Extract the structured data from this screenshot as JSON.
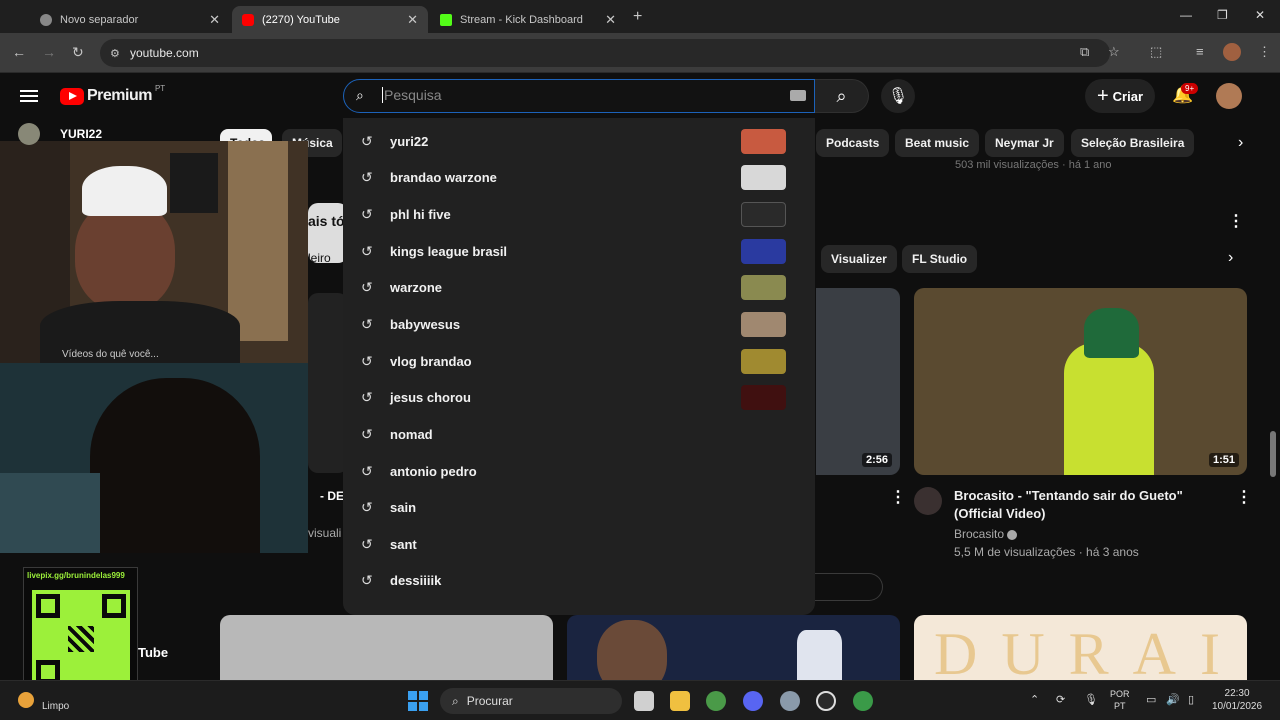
{
  "browser": {
    "tabs": [
      {
        "title": "Novo separador",
        "active": false
      },
      {
        "title": "(2270) YouTube",
        "active": true
      },
      {
        "title": "Stream - Kick Dashboard",
        "active": false
      }
    ],
    "url": "youtube.com"
  },
  "youtube": {
    "brand": "Premium",
    "region": "PT",
    "search_placeholder": "Pesquisa",
    "create_label": "Criar",
    "notification_count": "9+",
    "chips_row1": [
      "Podcasts",
      "Beat music",
      "Neymar Jr",
      "Seleção Brasileira"
    ],
    "chips_left_partial": [
      "Todos",
      "Música"
    ],
    "chips_row2": [
      "Visualizer",
      "FL Studio"
    ],
    "channel_overlay_name": "YURI22",
    "video_left_partial_meta": "Vídeos do quê você...",
    "video_partial_top_meta": "503 mil visualizações · há 1 ano",
    "videos": [
      {
        "duration": "2:56"
      },
      {
        "duration": "1:51",
        "title": "Brocasito - \"Tentando sair do Gueto\" (Official Video)",
        "channel": "Brocasito",
        "meta": "5,5 M de visualizações · há 3 anos"
      }
    ],
    "partial_texts": {
      "left_a": "ais tó",
      "left_b": "leiro",
      "left_c": "- DES",
      "left_d": "visuali",
      "bottom_left": "Tube"
    }
  },
  "suggestions": [
    {
      "text": "yuri22",
      "has_thumb": true,
      "thumb_color": "#c85a40"
    },
    {
      "text": "brandao warzone",
      "has_thumb": true,
      "thumb_color": "#d8d8d8"
    },
    {
      "text": "phl hi five",
      "has_thumb": true,
      "thumb_color": "#2a2a2a"
    },
    {
      "text": "kings league brasil",
      "has_thumb": true,
      "thumb_color": "#2a3aa0"
    },
    {
      "text": "warzone",
      "has_thumb": true,
      "thumb_color": "#8a8a50"
    },
    {
      "text": "babywesus",
      "has_thumb": true,
      "thumb_color": "#a08870"
    },
    {
      "text": "vlog brandao",
      "has_thumb": true,
      "thumb_color": "#a08a30"
    },
    {
      "text": "jesus chorou",
      "has_thumb": true,
      "thumb_color": "#401010"
    },
    {
      "text": "nomad",
      "has_thumb": false
    },
    {
      "text": "antonio pedro",
      "has_thumb": false
    },
    {
      "text": "sain",
      "has_thumb": false
    },
    {
      "text": "sant",
      "has_thumb": false
    },
    {
      "text": "dessiiiik",
      "has_thumb": false
    }
  ],
  "overlay": {
    "qr_label": "livepix.gg/brunindelas999"
  },
  "taskbar": {
    "weather": "Limpo",
    "search_label": "Procurar",
    "lang_line1": "POR",
    "lang_line2": "PT",
    "time": "22:30",
    "date": "10/01/2026"
  },
  "colors": {
    "accent_blue": "#1c62b9",
    "youtube_red": "#ff0000",
    "background": "#0f0f0f"
  }
}
